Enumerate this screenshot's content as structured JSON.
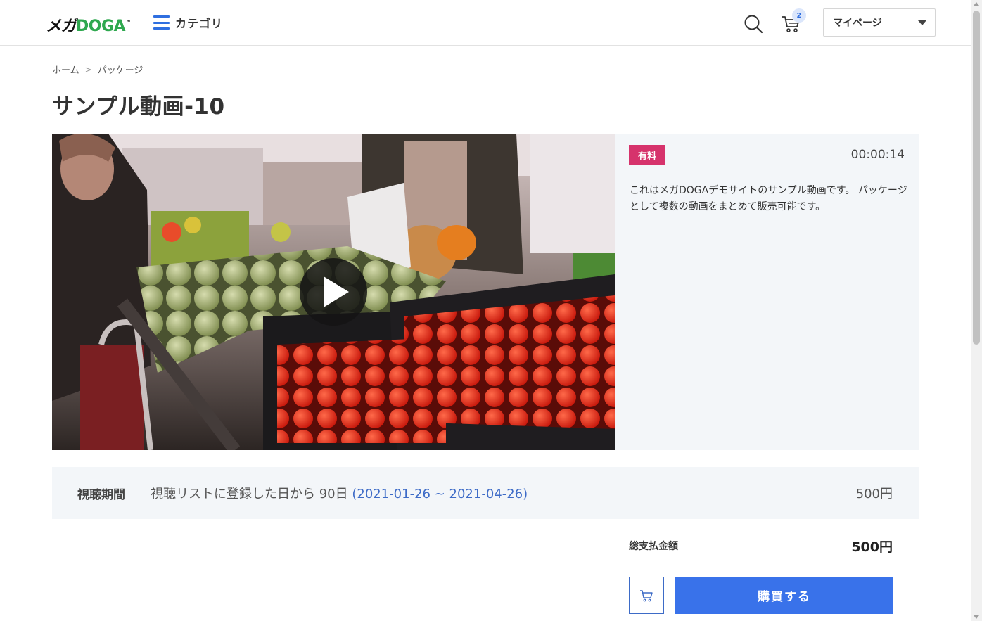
{
  "header": {
    "logo_jp": "メガ",
    "logo_en": "DOGA",
    "logo_tm": "™",
    "category_label": "カテゴリ",
    "cart_count": "2",
    "mypage_label": "マイページ"
  },
  "breadcrumb": {
    "home": "ホーム",
    "separator": ">",
    "current": "パッケージ"
  },
  "page_title": "サンプル動画-10",
  "video": {
    "duration": "00:00:14",
    "badge": "有料",
    "description": "これはメガDOGAデモサイトのサンプル動画です。 パッケージとして複数の動画をまとめて販売可能です。"
  },
  "period": {
    "label": "視聴期間",
    "text": "視聴リストに登録した日から 90日",
    "dates": "(2021-01-26 ~ 2021-04-26)",
    "price": "500円"
  },
  "total": {
    "label": "総支払金額",
    "value": "500円"
  },
  "buy_label": "購買する",
  "colors": {
    "brand_green": "#2fa84f",
    "accent_blue": "#3972ea",
    "badge_pink": "#d6336c",
    "panel_bg": "#f3f6f9"
  }
}
